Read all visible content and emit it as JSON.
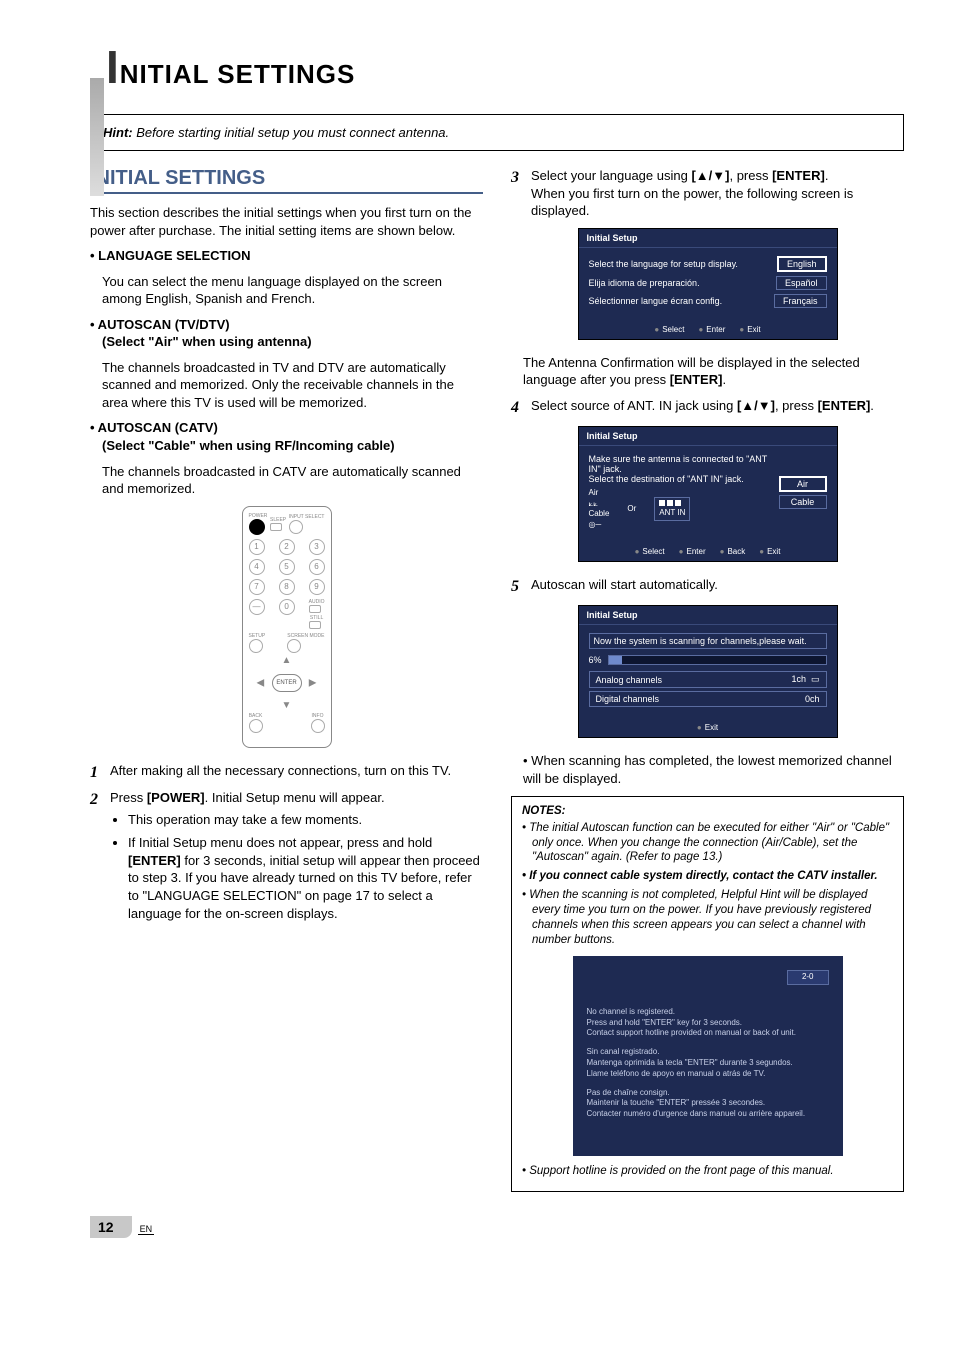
{
  "sidebar": true,
  "page_title_big": "I",
  "page_title_rest": "NITIAL SETTINGS",
  "hint_label": "Hint:",
  "hint_text": "Before starting initial setup you must connect antenna.",
  "section_heading": "INITIAL SETTINGS",
  "intro": "This section describes the initial settings when you first turn on the power after purchase. The initial setting items are shown below.",
  "feat1_head": "• LANGUAGE SELECTION",
  "feat1_body": "You can select the menu language displayed on the screen among English, Spanish and French.",
  "feat2_head": "• AUTOSCAN (TV/DTV)",
  "feat2_sub": "(Select \"Air\" when using antenna)",
  "feat2_body": "The channels broadcasted in TV and DTV are automatically scanned and memorized. Only the receivable channels in the area where this TV is used will be memorized.",
  "feat3_head": "• AUTOSCAN (CATV)",
  "feat3_sub": "(Select \"Cable\" when using RF/Incoming cable)",
  "feat3_body": "The channels broadcasted in CATV are automatically scanned and memorized.",
  "remote": {
    "power": "POWER",
    "sleep": "SLEEP",
    "input": "INPUT SELECT",
    "audio": "AUDIO",
    "still": "STILL",
    "setup": "SETUP",
    "screen": "SCREEN MODE",
    "back": "BACK",
    "info": "INFO",
    "enter": "ENTER",
    "nums": [
      "1",
      "2",
      "3",
      "4",
      "5",
      "6",
      "7",
      "8",
      "9",
      "—",
      "0"
    ]
  },
  "step1": "After making all the necessary connections, turn on this TV.",
  "step2_main_a": "Press ",
  "step2_power": "[POWER]",
  "step2_main_b": ". Initial Setup menu will appear.",
  "step2_b1": "This operation may take a few moments.",
  "step2_b2_a": "If Initial Setup menu does not appear, press and hold ",
  "step2_enter": "[ENTER]",
  "step2_b2_b": " for 3 seconds, initial setup will appear then proceed to step 3. If you have already turned on this TV before, refer to \"LANGUAGE SELECTION\" on page 17 to select a language for the on-screen displays.",
  "step3_a": "Select your language using ",
  "step3_keys": "[▲/▼]",
  "step3_b": ", press ",
  "step3_enter": "[ENTER]",
  "step3_c": ".",
  "step3_body": "When you first turn on the power, the following screen is displayed.",
  "lang_screen": {
    "title": "Initial Setup",
    "rows": [
      {
        "label": "Select the language for setup display.",
        "opt": "English",
        "selected": true
      },
      {
        "label": "Elija idioma de preparación.",
        "opt": "Español",
        "selected": false
      },
      {
        "label": "Sélectionner langue écran config.",
        "opt": "Français",
        "selected": false
      }
    ],
    "footer": [
      "Select",
      "Enter",
      "Exit"
    ]
  },
  "step3_after_a": "The Antenna Confirmation will be displayed in the selected language after you press ",
  "step3_after_enter": "[ENTER]",
  "step3_after_b": ".",
  "step4_a": "Select source of ANT. IN jack using ",
  "step4_keys": "[▲/▼]",
  "step4_b": ", press ",
  "step4_enter": "[ENTER]",
  "step4_c": ".",
  "ant_screen": {
    "title": "Initial Setup",
    "line1": "Make sure the antenna is connected to \"ANT IN\" jack.",
    "line2": "Select the destination of \"ANT IN\" jack.",
    "air": "Air",
    "cable": "Cable",
    "or": "Or",
    "antin": "ANT IN",
    "opts": [
      "Air",
      "Cable"
    ],
    "footer": [
      "Select",
      "Enter",
      "Back",
      "Exit"
    ]
  },
  "step5": "Autoscan will start automatically.",
  "scan_screen": {
    "title": "Initial Setup",
    "msg": "Now the system is scanning for channels,please wait.",
    "pct": "6%",
    "analog_label": "Analog channels",
    "analog_val": "1ch",
    "digital_label": "Digital channels",
    "digital_val": "0ch",
    "footer": [
      "Exit"
    ]
  },
  "scan_done": "When scanning has completed, the lowest memorized channel will be displayed.",
  "notes_head": "NOTES:",
  "note1": "The initial Autoscan function can be executed for either \"Air\" or \"Cable\" only once. When you change the connection (Air/Cable), set the \"Autoscan\" again. (Refer to page 13.)",
  "note2": "If you connect cable system directly, contact the CATV installer.",
  "note3": "When the scanning is not completed, Helpful Hint will be displayed every time you turn on the power. If you have previously registered channels when this screen appears you can select a channel with number buttons.",
  "hint_screen": {
    "chan": "2-0",
    "en": [
      "No channel is registered.",
      "Press and hold \"ENTER\" key for 3 seconds.",
      "Contact support hotline provided on manual or back of unit."
    ],
    "es": [
      "Sin canal registrado.",
      "Mantenga oprimida la tecla \"ENTER\" durante 3 segundos.",
      "Llame teléfono de apoyo en manual o atrás de TV."
    ],
    "fr": [
      "Pas de chaîne consign.",
      "Maintenir la touche \"ENTER\" pressée 3 secondes.",
      "Contacter numéro d'urgence dans manuel ou arrière appareil."
    ]
  },
  "note4": "Support hotline is provided on the front page of this manual.",
  "page_number": "12",
  "page_lang": "EN"
}
